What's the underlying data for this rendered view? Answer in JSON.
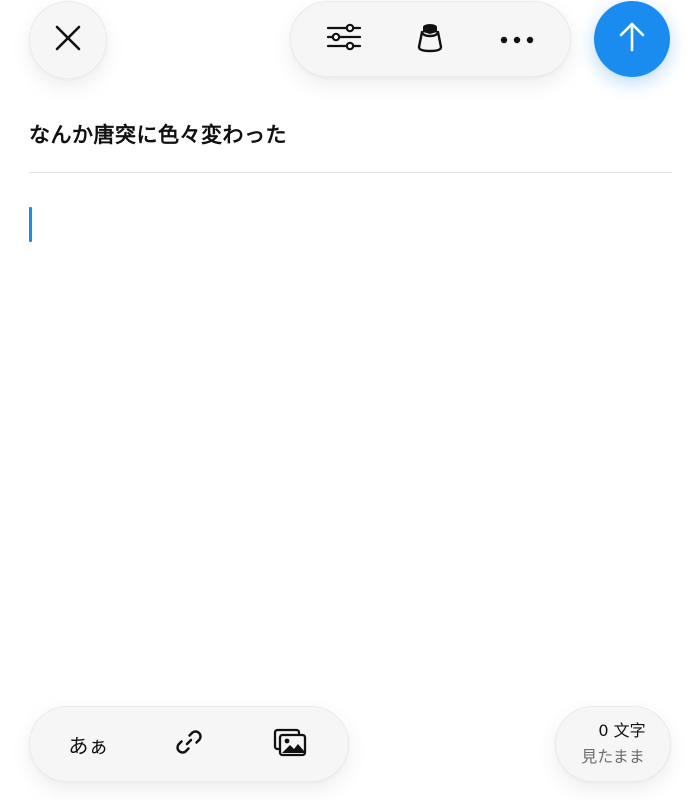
{
  "editor": {
    "title": "なんか唐突に色々変わった",
    "body": ""
  },
  "toolbar": {
    "close_icon": "close-icon",
    "settings_icon": "sliders-icon",
    "ink_icon": "ink-bottle-icon",
    "more_icon": "more-dots-icon",
    "send_icon": "arrow-up-icon",
    "accent_color": "#1a8cf0"
  },
  "bottom_toolbar": {
    "text_style_label": "あぁ",
    "link_icon": "link-icon",
    "image_icon": "images-icon"
  },
  "counter": {
    "count": "0",
    "unit": "文字",
    "status": "見たまま"
  }
}
